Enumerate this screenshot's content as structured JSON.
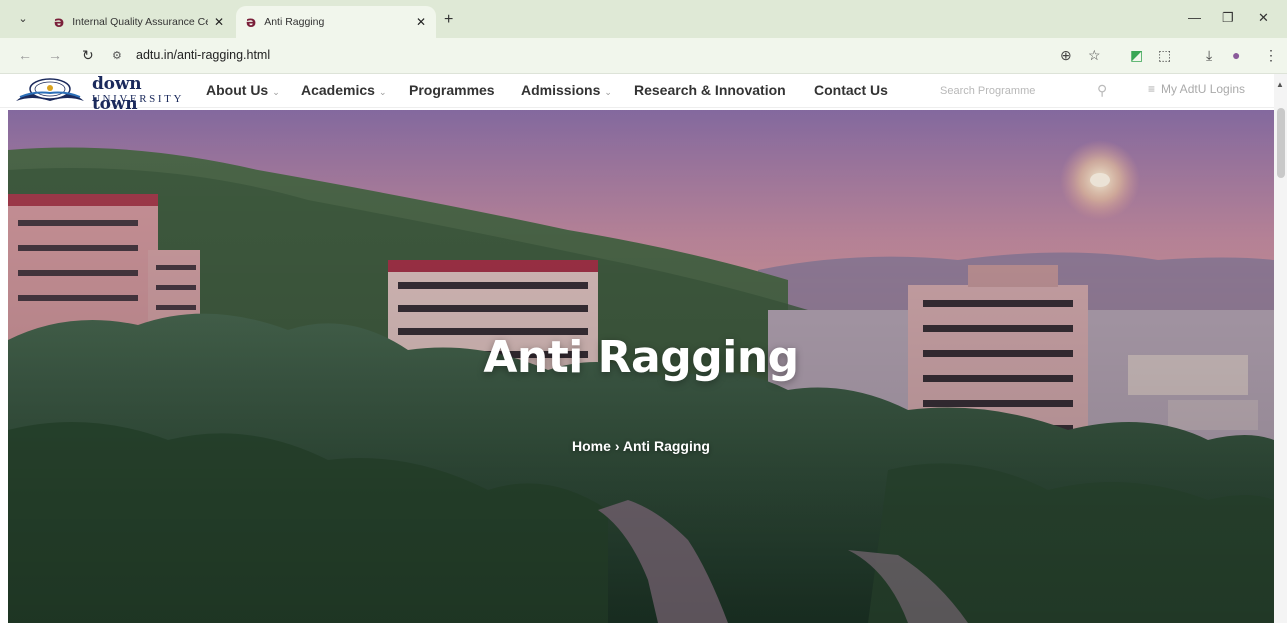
{
  "browser": {
    "tabs": [
      {
        "title": "Internal Quality Assurance Cell",
        "favicon": "adtu-favicon-icon"
      },
      {
        "title": "Anti Ragging",
        "favicon": "adtu-favicon-icon"
      }
    ],
    "url": "adtu.in/anti-ragging.html"
  },
  "site": {
    "logo": {
      "top": "down town",
      "bottom": "UNIVERSITY"
    },
    "menu": [
      {
        "label": "About Us",
        "dropdown": true
      },
      {
        "label": "Academics",
        "dropdown": true
      },
      {
        "label": "Programmes",
        "dropdown": false
      },
      {
        "label": "Admissions",
        "dropdown": true
      },
      {
        "label": "Research & Innovation",
        "dropdown": false
      },
      {
        "label": "Contact Us",
        "dropdown": false
      }
    ],
    "search_placeholder": "Search Programme",
    "logins_label": "My AdtU Logins"
  },
  "hero": {
    "title": "Anti Ragging",
    "breadcrumb": {
      "home": "Home",
      "separator": "›",
      "current": "Anti Ragging"
    }
  },
  "icons": {
    "chevron": "⌄",
    "search": "⚲",
    "menu": "≡"
  },
  "colors": {
    "brand": "#1b2a5c",
    "tabbar": "#dfe9d6",
    "toolbar": "#f1f6ec"
  }
}
